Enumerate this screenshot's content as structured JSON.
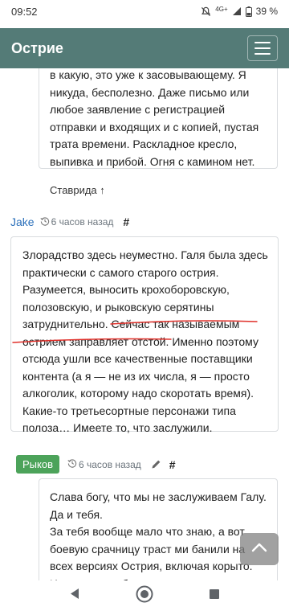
{
  "status_bar": {
    "time": "09:52",
    "network": "4G+",
    "battery": "39 %"
  },
  "header": {
    "title": "Острие"
  },
  "comments": [
    {
      "text": "в какую, это уже к засовывающему. Я никуда, бесполезно. Даже письмо или любое заявление с регистрацией отправки и входящих и с копией, пустая трата времени. Раскладное кресло, выпивка и прибой. Огня с камином нет.",
      "parent_link": "Ставрида ↑"
    },
    {
      "author": "Jake",
      "time": "6 часов назад",
      "hash": "#",
      "text": "Злорадство здесь неуместно. Галя была здесь практически с самого старого острия. Разумеется, выносить крохоборовскую, полозовскую, и рыковскую серятины затруднительно. Сейчас так называемым острием заправляет отстой. Именно поэтому отсюда ушли все качественные поставщики контента (а я — не из их числа, я — просто алкоголик, которому надо скоротать время). Какие-то третьесортные персонажи типа полоза… Имеете то, что заслужили."
    },
    {
      "author": "Рыков",
      "time": "6 часов назад",
      "hash": "#",
      "text": "Слава богу, что мы не заслуживаем Галу. Да и тебя.\nЗа тебя вообще мало что знаю, а вот боевую срачницу траст ми банили на всех версиях Острия, включая корыто. Из-за чего, собственно, и появилась такая вот"
    }
  ],
  "colors": {
    "header_bg": "#547b77",
    "author_link": "#2a6fba",
    "badge_bg": "#4ca35a",
    "annotation": "#e0302a"
  },
  "icons": {
    "history": "history-icon",
    "pencil": "pencil-icon",
    "scroll_top": "chevron-up-icon",
    "nav_back": "back-triangle-icon",
    "nav_home": "home-circle-icon",
    "nav_recent": "recent-square-icon"
  }
}
